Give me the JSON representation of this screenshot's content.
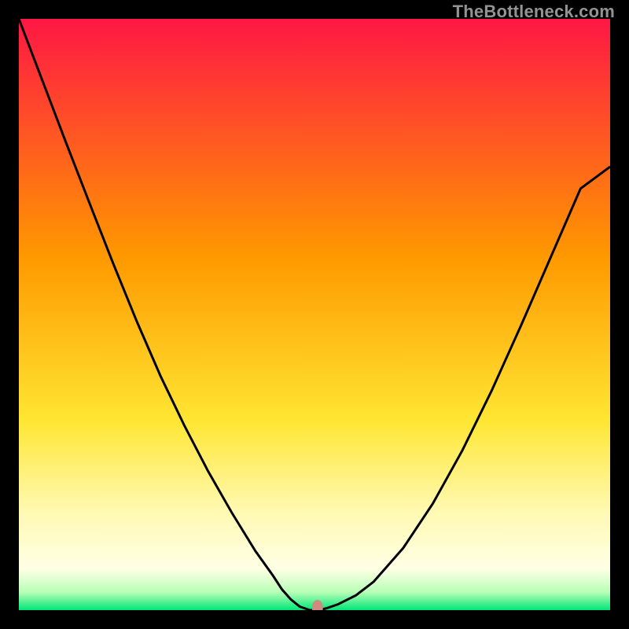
{
  "watermark": "TheBottleneck.com",
  "chart_data": {
    "type": "line",
    "title": "",
    "xlabel": "",
    "ylabel": "",
    "xlim": [
      0,
      1
    ],
    "ylim": [
      0,
      1
    ],
    "grid": false,
    "background": {
      "type": "vertical-gradient",
      "stops": [
        {
          "offset": 0.0,
          "color": "#ff1744"
        },
        {
          "offset": 0.4,
          "color": "#ff9800"
        },
        {
          "offset": 0.68,
          "color": "#ffe633"
        },
        {
          "offset": 0.83,
          "color": "#fff9b0"
        },
        {
          "offset": 0.93,
          "color": "#ffffe5"
        },
        {
          "offset": 0.97,
          "color": "#b6ffb6"
        },
        {
          "offset": 1.0,
          "color": "#00e676"
        }
      ]
    },
    "series": [
      {
        "name": "curve",
        "color": "#000000",
        "width": 3,
        "x": [
          0.0,
          0.04,
          0.08,
          0.12,
          0.16,
          0.2,
          0.24,
          0.28,
          0.32,
          0.36,
          0.4,
          0.43,
          0.445,
          0.46,
          0.475,
          0.492,
          0.508,
          0.52,
          0.54,
          0.57,
          0.6,
          0.65,
          0.7,
          0.75,
          0.8,
          0.85,
          0.9,
          0.95,
          1.0
        ],
        "y": [
          1.0,
          0.895,
          0.79,
          0.687,
          0.585,
          0.487,
          0.395,
          0.312,
          0.235,
          0.165,
          0.1,
          0.058,
          0.035,
          0.018,
          0.006,
          0.0,
          0.0,
          0.003,
          0.01,
          0.025,
          0.048,
          0.105,
          0.18,
          0.27,
          0.372,
          0.483,
          0.598,
          0.713,
          0.75
        ]
      }
    ],
    "marker": {
      "x": 0.505,
      "y": 0.004,
      "rx": 7,
      "ry": 10,
      "color": "#cf8b80"
    }
  }
}
